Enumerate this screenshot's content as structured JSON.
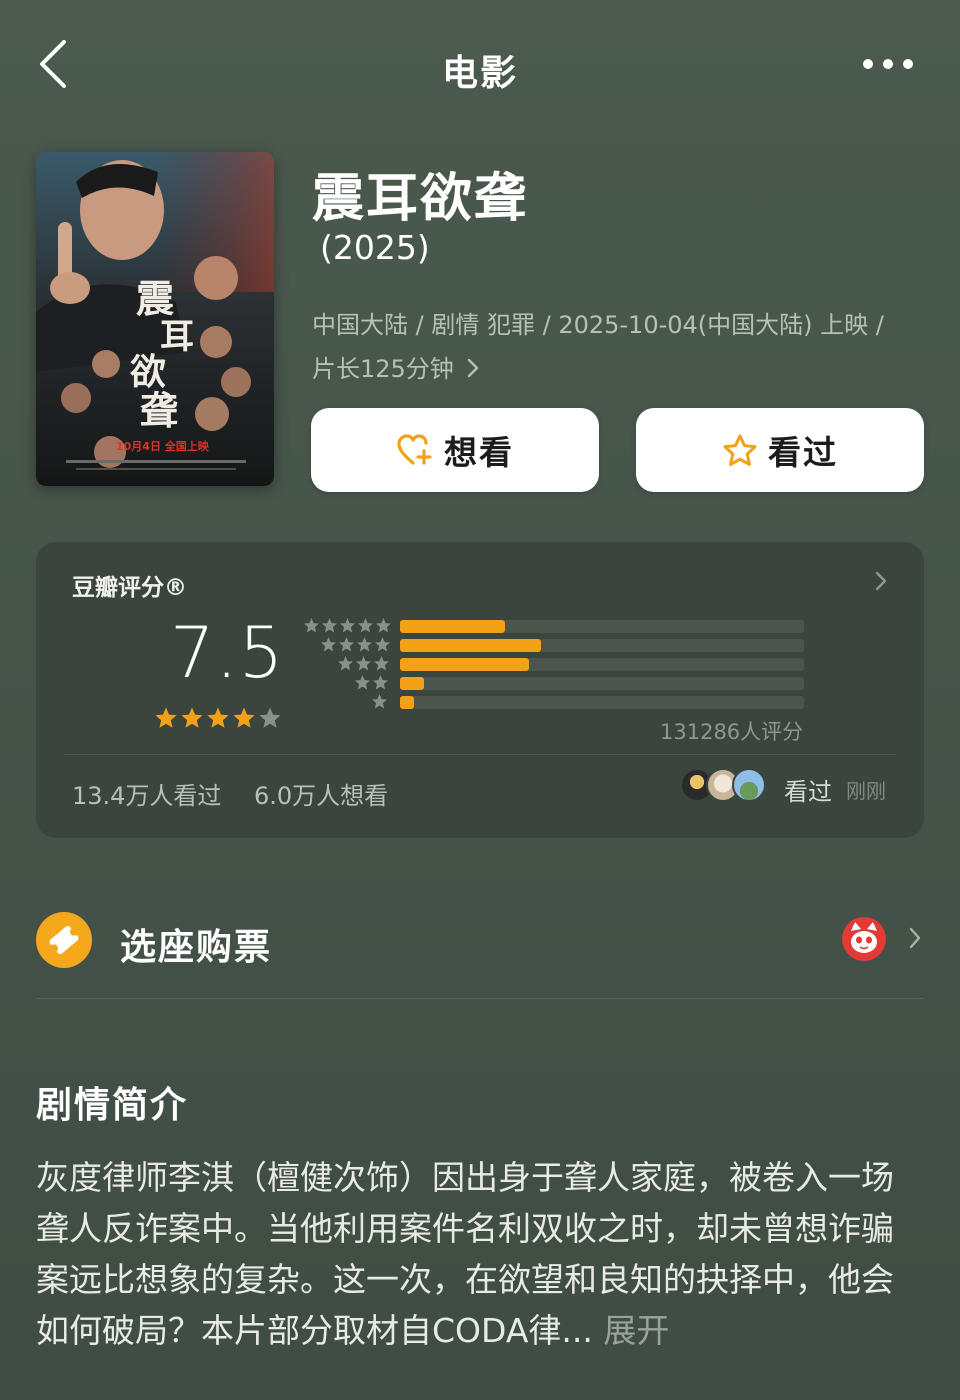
{
  "nav": {
    "title": "电影"
  },
  "movie": {
    "title": "震耳欲聋",
    "year": "(2025)",
    "meta_line1": "中国大陆 / 剧情 犯罪 / 2025-10-04(中国大陆) 上映 /",
    "meta_line2": "片长125分钟",
    "poster": {
      "title_chars": [
        "震",
        "耳",
        "欲",
        "聋"
      ],
      "release_text": "10月4日 全国上映"
    }
  },
  "actions": {
    "want_label": "想看",
    "seen_label": "看过"
  },
  "rating": {
    "title": "豆瓣评分®",
    "score": "7.5",
    "score_stars": 4,
    "distribution": [
      {
        "stars": 5,
        "fraction": 0.26
      },
      {
        "stars": 4,
        "fraction": 0.35
      },
      {
        "stars": 3,
        "fraction": 0.32
      },
      {
        "stars": 2,
        "fraction": 0.06
      },
      {
        "stars": 1,
        "fraction": 0.03
      }
    ],
    "count_text": "131286人评分",
    "seen_stat": "13.4万人看过",
    "want_stat": "6.0万人想看",
    "friends_action": "看过",
    "friends_time": "刚刚"
  },
  "ticket": {
    "label": "选座购票"
  },
  "synopsis": {
    "heading": "剧情简介",
    "text": "灰度律师李淇（檀健次饰）因出身于聋人家庭，被卷入一场聋人反诈案中。当他利用案件名利双收之时，却未曾想诈骗案远比想象的复杂。这一次，在欲望和良知的抉择中，他会如何破局？本片部分取材自CODA律...",
    "expand_label": "展开"
  },
  "colors": {
    "background": "#46544a",
    "card": "#3a453d",
    "accent": "#f3a116",
    "star_gray": "#8a8f88",
    "text_muted": "#b8c0b6"
  },
  "icons": [
    "back-icon",
    "more-icon",
    "heart-plus-icon",
    "star-outline-icon",
    "star-icon",
    "chevron-right-icon",
    "ticket-icon",
    "cat-eye-logo-icon"
  ]
}
